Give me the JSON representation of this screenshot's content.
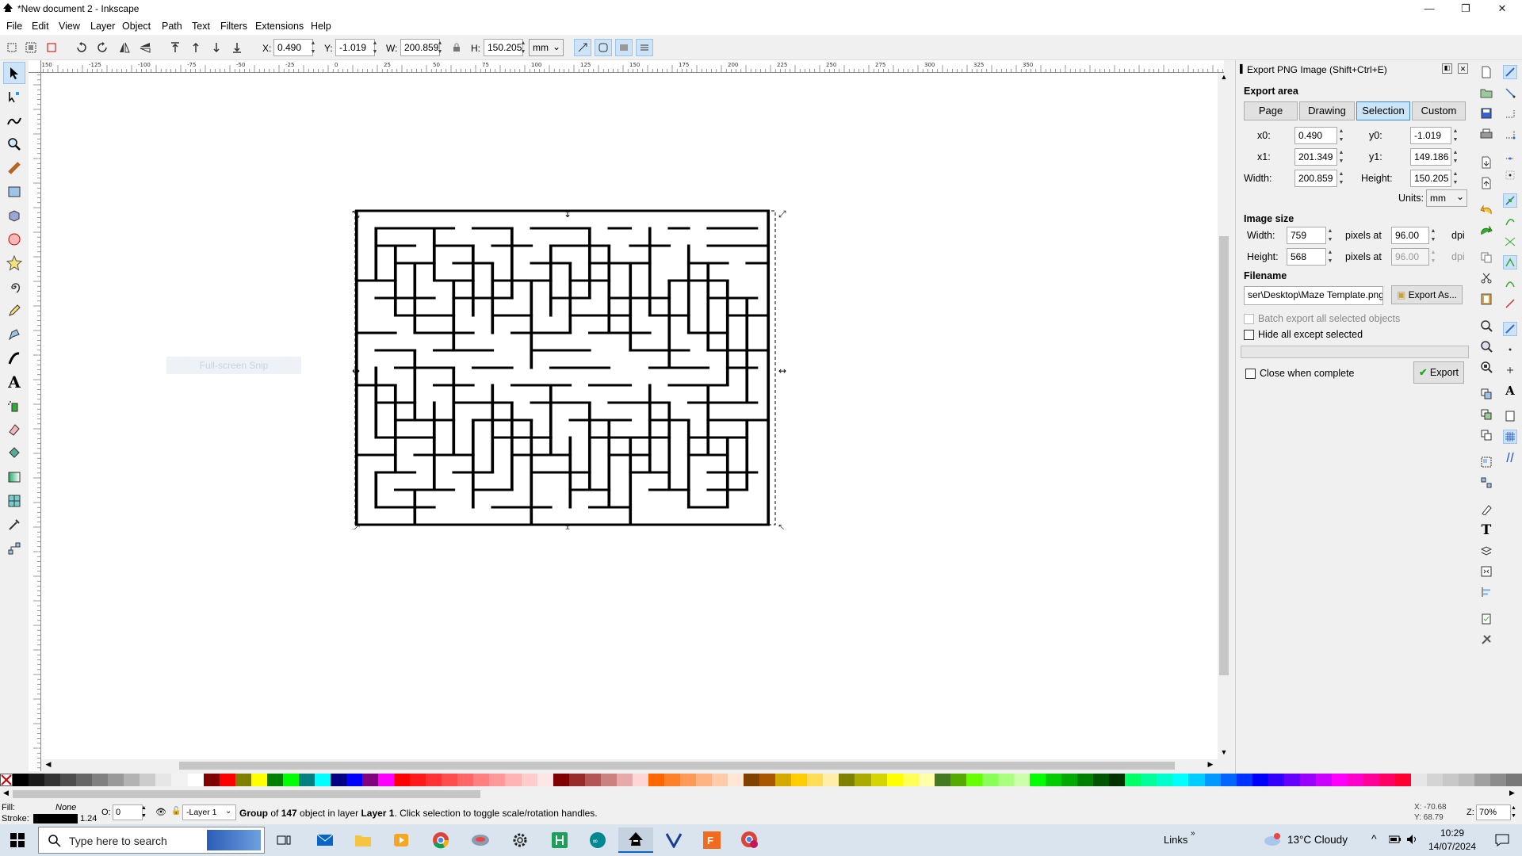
{
  "window": {
    "title": "*New document 2 - Inkscape"
  },
  "menu": [
    "File",
    "Edit",
    "View",
    "Layer",
    "Object",
    "Path",
    "Text",
    "Filters",
    "Extensions",
    "Help"
  ],
  "toolbar": {
    "x_label": "X:",
    "x_value": "0.490",
    "y_label": "Y:",
    "y_value": "-1.019",
    "w_label": "W:",
    "w_value": "200.859",
    "h_label": "H:",
    "h_value": "150.205",
    "unit": "mm"
  },
  "ruler_labels": [
    "-150",
    "-125",
    "-100",
    "-75",
    "-50",
    "-25",
    "0",
    "25",
    "50",
    "75",
    "100",
    "125",
    "150",
    "175",
    "200",
    "225",
    "250",
    "275",
    "300",
    "325",
    "350"
  ],
  "canvas": {
    "watermark": "Full-screen Snip"
  },
  "dialog": {
    "title": "Export PNG Image (Shift+Ctrl+E)",
    "export_area": "Export area",
    "tabs": [
      "Page",
      "Drawing",
      "Selection",
      "Custom"
    ],
    "active_tab": "Selection",
    "x0_label": "x0:",
    "x0": "0.490",
    "y0_label": "y0:",
    "y0": "-1.019",
    "x1_label": "x1:",
    "x1": "201.349",
    "y1_label": "y1:",
    "y1": "149.186",
    "width_label": "Width:",
    "width": "200.859",
    "height_label": "Height:",
    "height": "150.205",
    "units_label": "Units:",
    "units": "mm",
    "image_size": "Image size",
    "img_width_label": "Width:",
    "img_width": "759",
    "img_height_label": "Height:",
    "img_height": "568",
    "pixels_at": "pixels at",
    "dpi_x": "96.00",
    "dpi_y": "96.00",
    "dpi": "dpi",
    "filename_label": "Filename",
    "filename": "ser\\Desktop\\Maze Template.png",
    "export_as": "Export As...",
    "batch": "Batch export all selected objects",
    "hide": "Hide all except selected",
    "close_when": "Close when complete",
    "export": "Export"
  },
  "status": {
    "fill_label": "Fill:",
    "fill_value": "None",
    "stroke_label": "Stroke:",
    "stroke_width": "1.24",
    "opacity_label": "O:",
    "opacity": "0",
    "layer": "-Layer 1",
    "msg_pre": "Group",
    "msg_of": " of ",
    "msg_count": "147",
    "msg_mid": " object in layer ",
    "msg_layer": "Layer 1",
    "msg_post": ". Click selection to toggle scale/rotation handles.",
    "cursor_x": "X: -70.68",
    "cursor_y": "Y: 68.79",
    "zoom_label": "Z:",
    "zoom": "70%"
  },
  "taskbar": {
    "search_placeholder": "Type here to search",
    "links": "Links",
    "weather": "13°C  Cloudy",
    "time": "10:29",
    "date": "14/07/2024"
  },
  "palette_colors": [
    "#000000",
    "#1a1a1a",
    "#333333",
    "#4d4d4d",
    "#666666",
    "#808080",
    "#999999",
    "#b3b3b3",
    "#cccccc",
    "#e6e6e6",
    "#f2f2f2",
    "#ffffff",
    "#800000",
    "#ff0000",
    "#808000",
    "#ffff00",
    "#008000",
    "#00ff00",
    "#008080",
    "#00ffff",
    "#000080",
    "#0000ff",
    "#800080",
    "#ff00ff",
    "#ff0000",
    "#ff1a1a",
    "#ff3333",
    "#ff4d4d",
    "#ff6666",
    "#ff8080",
    "#ff9999",
    "#ffb3b3",
    "#ffcccc",
    "#ffe6e6",
    "#800000",
    "#992a2a",
    "#b35555",
    "#cc8080",
    "#e6aaaa",
    "#ffd5d5",
    "#ff6600",
    "#ff7f2a",
    "#ff9955",
    "#ffb380",
    "#ffccaa",
    "#ffe6d5",
    "#804000",
    "#aa5500",
    "#d4aa00",
    "#ffcc00",
    "#ffdd55",
    "#ffee aa",
    "#808000",
    "#aaaa00",
    "#d4d400",
    "#ffff00",
    "#ffff55",
    "#ffffaa",
    "#447821",
    "#55aa00",
    "#66ff00",
    "#88ff55",
    "#aaff80",
    "#ccffaa",
    "#00ff00",
    "#00cc00",
    "#00aa00",
    "#008000",
    "#005500",
    "#003300",
    "#00ff66",
    "#00ff99",
    "#00ffcc",
    "#00ffff",
    "#00ccff",
    "#0099ff",
    "#0066ff",
    "#0033ff",
    "#0000ff",
    "#3300ff",
    "#6600ff",
    "#9900ff",
    "#cc00ff",
    "#ff00ff",
    "#ff00cc",
    "#ff0099",
    "#ff0066",
    "#ff0033",
    "#e6e6e6",
    "#d4d4d4",
    "#c8c8c8",
    "#bcbcbc",
    "#a0a0a0",
    "#8c8c8c",
    "#787878"
  ]
}
